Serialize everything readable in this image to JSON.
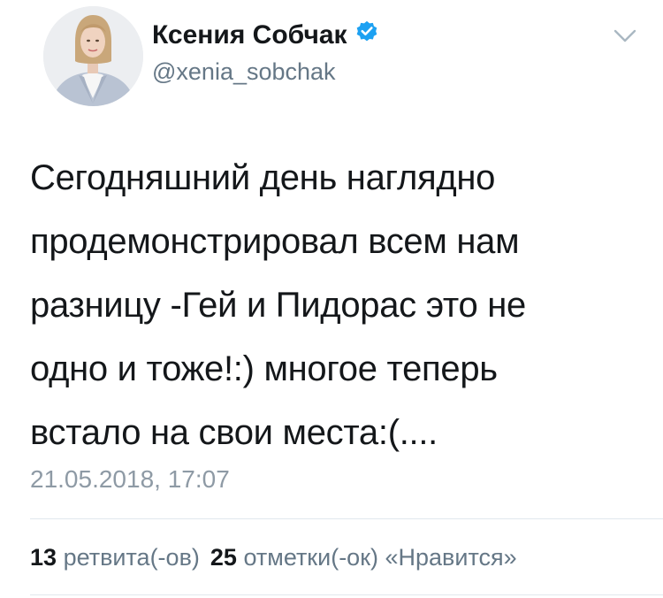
{
  "author": {
    "display_name": "Ксения Собчак",
    "handle": "@xenia_sobchak",
    "verified": true,
    "avatar": "profile-photo",
    "verified_color": "#1da1f2"
  },
  "menu_icon": "chevron-down-icon",
  "tweet": {
    "text": "Сегодняшний день наглядно\nпродемонстрировал всем нам\nразницу -Гей  и Пидорас  это не\nодно и тоже!:) многое теперь\nвстало на свои места:(....",
    "timestamp": "21.05.2018, 17:07"
  },
  "stats": {
    "retweets_count": "13",
    "retweets_label": "ретвита(-ов)",
    "likes_count": "25",
    "likes_label": "отметки(-ок) «Нравится»"
  },
  "colors": {
    "text": "#14171a",
    "secondary": "#657786",
    "timestamp": "#8e9aa5",
    "divider": "#e1e8ed"
  }
}
